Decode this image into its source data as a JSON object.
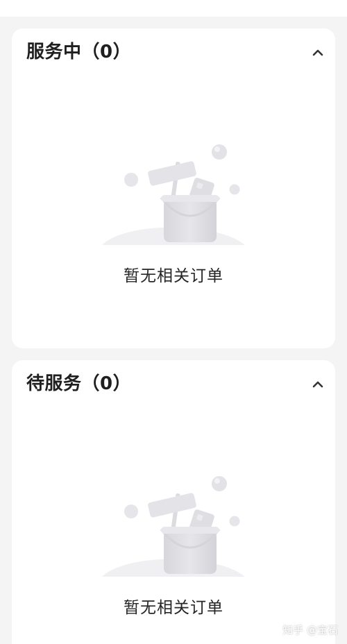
{
  "sections": [
    {
      "title": "服务中（0）",
      "empty_text": "暂无相关订单",
      "toggle_icon": "chevron-up-icon"
    },
    {
      "title": "待服务（0）",
      "empty_text": "暂无相关订单",
      "toggle_icon": "chevron-up-icon"
    }
  ],
  "empty_illustration_icon": "empty-bucket-illustration-icon",
  "watermark": "知乎 @宝石",
  "colors": {
    "page_background": "#f4f4f4",
    "card_background": "#ffffff",
    "title_text": "#1f1f1f",
    "illustration_gray": "#e4e4e7"
  }
}
